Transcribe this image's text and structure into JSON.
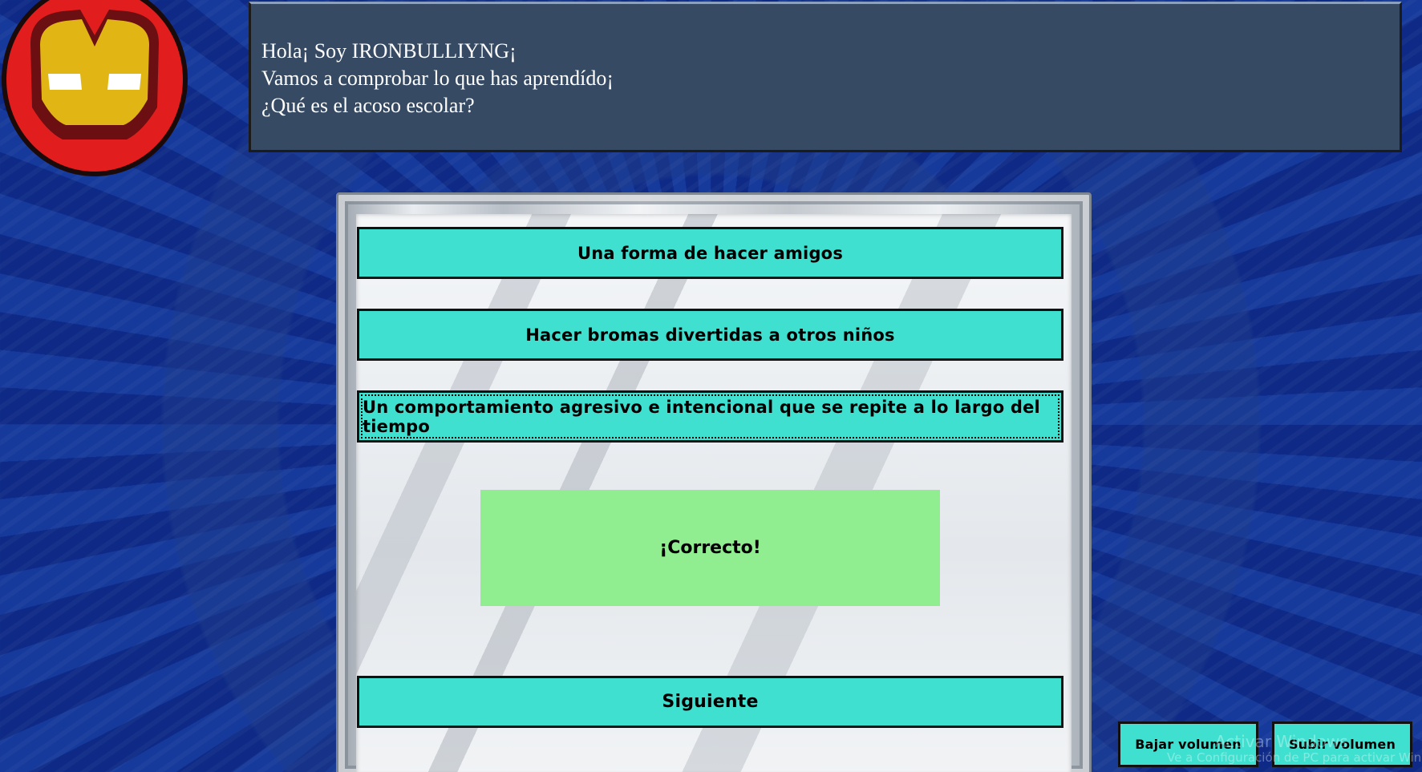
{
  "dialog": {
    "line1": "Hola¡ Soy IRONBULLIYNG¡",
    "line2": "Vamos a comprobar lo que has aprendído¡",
    "line3": "¿Qué es el acoso escolar?"
  },
  "avatar": {
    "icon": "iron-man-mask-icon"
  },
  "answers": [
    {
      "label": "Una forma de hacer amigos"
    },
    {
      "label": "Hacer bromas divertidas a otros niños"
    },
    {
      "label": "Un comportamiento agresivo e intencional que se repite a lo largo del tiempo"
    }
  ],
  "feedback": {
    "text": "¡Correcto!",
    "color": "#90ee90"
  },
  "next_button": {
    "label": "Siguiente"
  },
  "volume": {
    "down_label": "Bajar volumen",
    "up_label": "Subir volumen"
  },
  "watermark": {
    "line1": "Activar Windows",
    "line2": "Ve a Configuración de PC para activar Windows."
  },
  "colors": {
    "button": "#40e0d0",
    "dialog_bg": "#364a63",
    "background": "#10318f"
  }
}
